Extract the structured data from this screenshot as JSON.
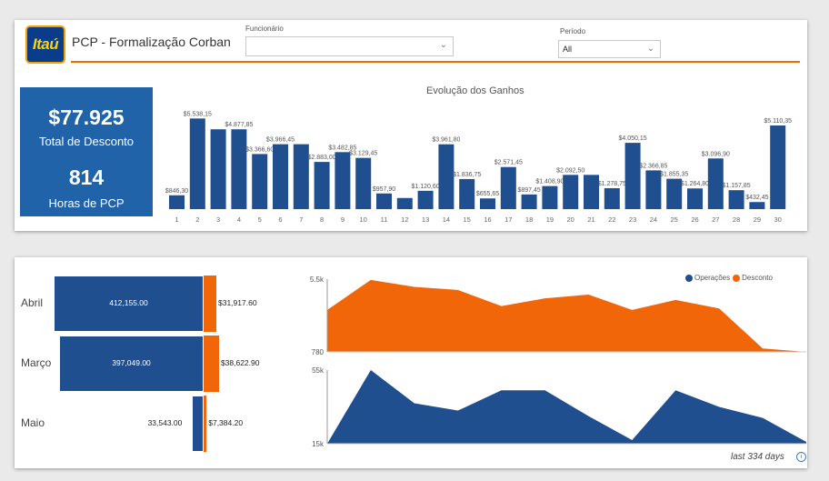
{
  "header": {
    "logo_text": "Itaú",
    "title": "PCP - Formalização Corban"
  },
  "slicers": {
    "funcionario": {
      "label": "Funcionário",
      "value": ""
    },
    "periodo": {
      "label": "Período",
      "value": "All"
    }
  },
  "kpis": {
    "desconto_value": "$77.925",
    "desconto_label": "Total de Desconto",
    "horas_value": "814",
    "horas_label": "Horas de PCP"
  },
  "colors": {
    "blue": "#204f90",
    "orange": "#f2660a",
    "accent": "#ef6c00"
  },
  "chart_data": [
    {
      "type": "bar",
      "title": "Evolução dos Ganhos",
      "categories": [
        "1",
        "2",
        "3",
        "4",
        "5",
        "6",
        "7",
        "8",
        "9",
        "10",
        "11",
        "12",
        "13",
        "14",
        "15",
        "16",
        "17",
        "18",
        "19",
        "20",
        "21",
        "22",
        "23",
        "24",
        "25",
        "26",
        "27",
        "28",
        "29",
        "30"
      ],
      "values": [
        846.3,
        5538.15,
        4877.85,
        4877.85,
        3366.6,
        3966.45,
        3966.45,
        2883.0,
        3482.85,
        3129.45,
        957.9,
        680.0,
        1120.6,
        3961.8,
        1836.75,
        655.65,
        2571.45,
        897.45,
        1408.9,
        2092.5,
        2092.5,
        1278.75,
        4050.15,
        2366.85,
        1855.35,
        1264.8,
        3096.9,
        1157.85,
        432.45,
        5110.35
      ],
      "labels": [
        "$846,30",
        "$5.538,15",
        "",
        "$4.877,85",
        "$3.366,60",
        "$3.966,45",
        "",
        "$2.883,00",
        "$3.482,85",
        "$3.129,45",
        "$957,90",
        "",
        "$1.120,60",
        "$3.961,80",
        "$1.836,75",
        "$655,65",
        "$2.571,45",
        "$897,45",
        "$1.408,90",
        "$2.092,50",
        "",
        "$1.278,75",
        "$4.050,15",
        "$2.366,85",
        "$1.855,35",
        "$1.264,80",
        "$3.096,90",
        "$1.157,85",
        "$432,45",
        "$5.110,35"
      ],
      "ylim": [
        0,
        6000
      ]
    },
    {
      "type": "bar",
      "orientation": "horizontal-stacked",
      "categories": [
        "Abril",
        "Março",
        "Maio"
      ],
      "series": [
        {
          "name": "Operações",
          "values": [
            412155.0,
            397049.0,
            33543.0
          ],
          "labels": [
            "412,155.00",
            "397,049.00",
            "33,543.00"
          ]
        },
        {
          "name": "Desconto",
          "values": [
            31917.6,
            38622.9,
            7384.2
          ],
          "labels": [
            "$31,917.60",
            "$38,622.90",
            "$7,384.20"
          ]
        }
      ]
    },
    {
      "type": "area",
      "legend": [
        "Operações",
        "Desconto"
      ],
      "legend_position": "top-right",
      "panels": [
        {
          "name": "Desconto",
          "y_ticks": [
            "5.5k",
            "780"
          ],
          "ylim": [
            780,
            5500
          ],
          "values": [
            3500,
            5450,
            5000,
            4800,
            3750,
            4250,
            4500,
            3500,
            4150,
            3600,
            1000,
            780
          ]
        },
        {
          "name": "Operações",
          "y_ticks": [
            "55k",
            "15k"
          ],
          "ylim": [
            15000,
            55000
          ],
          "values": [
            15000,
            55000,
            37000,
            33000,
            44000,
            44000,
            30000,
            17000,
            44000,
            35000,
            29000,
            16000
          ]
        }
      ]
    }
  ],
  "footer": {
    "note": "last 334 days"
  }
}
